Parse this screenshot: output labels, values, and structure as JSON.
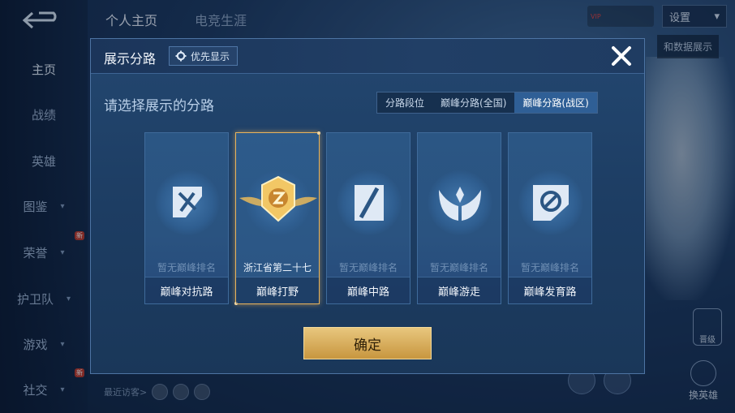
{
  "nav": {
    "items": [
      {
        "label": "主页",
        "active": true,
        "arrow": false,
        "badge": ""
      },
      {
        "label": "战绩",
        "active": false,
        "arrow": false,
        "badge": ""
      },
      {
        "label": "英雄",
        "active": false,
        "arrow": false,
        "badge": ""
      },
      {
        "label": "图鉴",
        "active": false,
        "arrow": true,
        "badge": ""
      },
      {
        "label": "荣誉",
        "active": false,
        "arrow": true,
        "badge": "新"
      },
      {
        "label": "护卫队",
        "active": false,
        "arrow": true,
        "badge": ""
      },
      {
        "label": "游戏",
        "active": false,
        "arrow": true,
        "badge": ""
      },
      {
        "label": "社交",
        "active": false,
        "arrow": true,
        "badge": "新"
      }
    ]
  },
  "top_tabs": [
    "个人主页",
    "电竞生涯"
  ],
  "header": {
    "vip_label": "VIP",
    "settings_label": "设置",
    "side_text": "和数据展示"
  },
  "visitors_label": "最近访客>",
  "swap_hero_label": "换英雄",
  "promote_label": "晋级",
  "modal": {
    "title": "展示分路",
    "priority_label": "优先显示",
    "subtitle": "请选择展示的分路",
    "tabs": [
      {
        "label": "分路段位",
        "active": false
      },
      {
        "label": "巅峰分路(全国)",
        "active": false
      },
      {
        "label": "巅峰分路(战区)",
        "active": true
      }
    ],
    "cards": [
      {
        "rank": "暂无巅峰排名",
        "name": "巅峰对抗路",
        "icon": "sword-lane-icon",
        "selected": false
      },
      {
        "rank": "浙江省第二十七",
        "name": "巅峰打野",
        "icon": "gold-rank-badge-icon",
        "selected": true
      },
      {
        "rank": "暂无巅峰排名",
        "name": "巅峰中路",
        "icon": "mid-lane-icon",
        "selected": false
      },
      {
        "rank": "暂无巅峰排名",
        "name": "巅峰游走",
        "icon": "support-wings-icon",
        "selected": false
      },
      {
        "rank": "暂无巅峰排名",
        "name": "巅峰发育路",
        "icon": "adc-lane-icon",
        "selected": false
      }
    ],
    "confirm_label": "确定"
  },
  "colors": {
    "accent_gold": "#e7b35c",
    "modal_bg": "#234770",
    "active_tab": "#2f5f96"
  }
}
